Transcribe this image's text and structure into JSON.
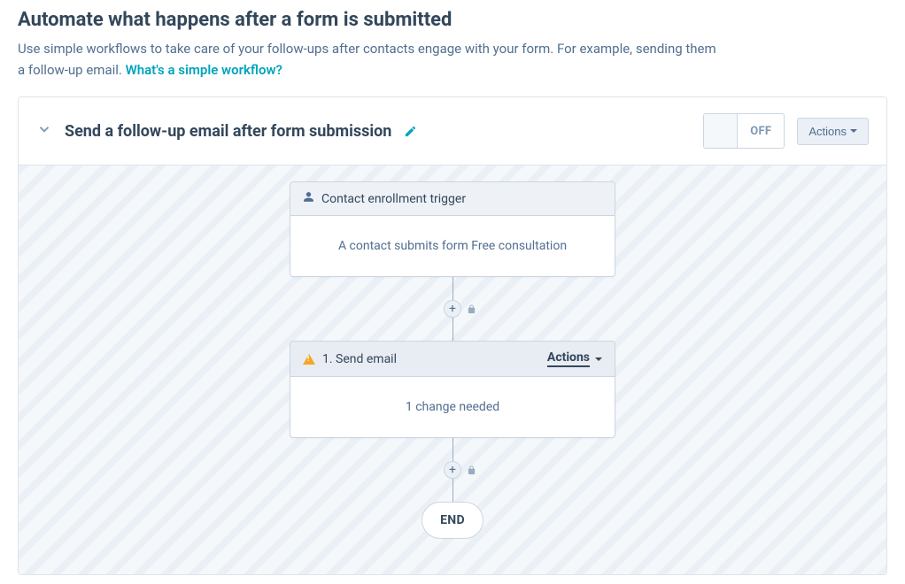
{
  "page": {
    "title": "Automate what happens after a form is submitted",
    "description_prefix": "Use simple workflows to take care of your follow-ups after contacts engage with your form. For example, sending them a follow-up email. ",
    "link_text": "What's a simple workflow?"
  },
  "workflow": {
    "title": "Send a follow-up email after form submission",
    "toggle_state": "OFF",
    "actions_button": "Actions"
  },
  "trigger_node": {
    "header": "Contact enrollment trigger",
    "body": "A contact submits form Free consultation"
  },
  "step_node": {
    "header": "1. Send email",
    "actions_label": "Actions",
    "body": "1 change needed"
  },
  "end_label": "END",
  "plus_label": "+"
}
